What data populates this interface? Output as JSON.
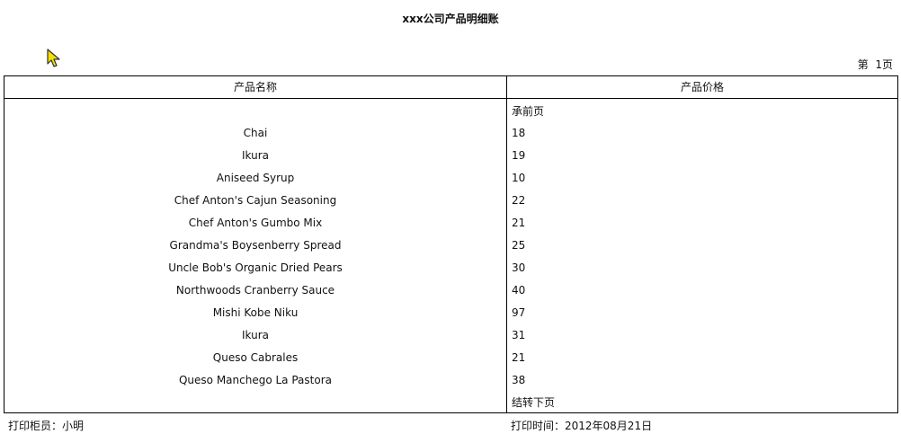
{
  "report": {
    "title": "xxx公司产品明细账",
    "page_label": "第  1页"
  },
  "table": {
    "headers": [
      "产品名称",
      "产品价格"
    ],
    "carry_forward_label": "承前页",
    "carry_over_label": "结转下页",
    "rows": [
      {
        "name": "Chai",
        "price": "18"
      },
      {
        "name": "Ikura",
        "price": "19"
      },
      {
        "name": "Aniseed Syrup",
        "price": "10"
      },
      {
        "name": "Chef Anton's Cajun Seasoning",
        "price": "22"
      },
      {
        "name": "Chef Anton's Gumbo Mix",
        "price": "21"
      },
      {
        "name": "Grandma's Boysenberry Spread",
        "price": "25"
      },
      {
        "name": "Uncle Bob's Organic Dried Pears",
        "price": "30"
      },
      {
        "name": "Northwoods Cranberry Sauce",
        "price": "40"
      },
      {
        "name": "Mishi Kobe Niku",
        "price": "97"
      },
      {
        "name": "Ikura",
        "price": "31"
      },
      {
        "name": "Queso Cabrales",
        "price": "21"
      },
      {
        "name": "Queso Manchego La Pastora",
        "price": "38"
      }
    ]
  },
  "footer": {
    "printer_label": "打印柜员：小明",
    "print_time_label": "打印时间：2012年08月21日"
  },
  "icons": {
    "cursor": "mouse-pointer-icon",
    "cursor_color": "#f2e000"
  }
}
